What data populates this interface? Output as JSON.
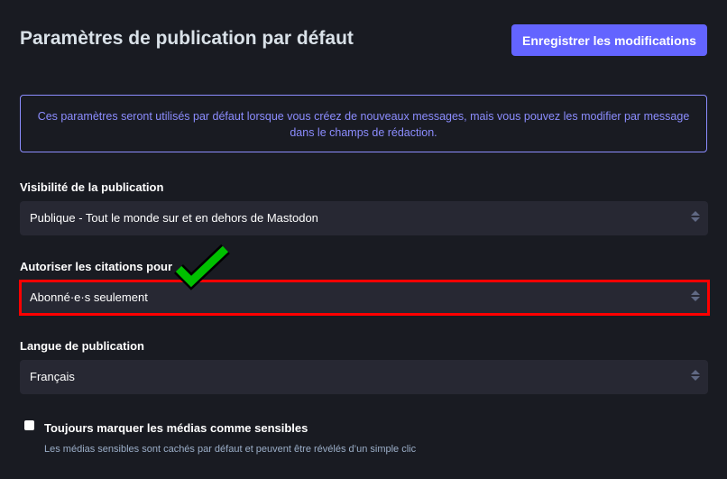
{
  "header": {
    "title": "Paramètres de publication par défaut",
    "save_label": "Enregistrer les modifications"
  },
  "notice": "Ces paramètres seront utilisés par défaut lorsque vous créez de nouveaux messages, mais vous pouvez les modifier par message dans le champs de rédaction.",
  "visibility": {
    "label": "Visibilité de la publication",
    "value": "Publique - Tout le monde sur et en dehors de Mastodon"
  },
  "quotes": {
    "label": "Autoriser les citations pour",
    "value": "Abonné·e·s seulement"
  },
  "language": {
    "label": "Langue de publication",
    "value": "Français"
  },
  "sensitive": {
    "label": "Toujours marquer les médias comme sensibles",
    "hint": "Les médias sensibles sont cachés par défaut et peuvent être révélés d’un simple clic",
    "checked": false
  },
  "colors": {
    "accent": "#6364ff",
    "highlight": "#ff0000",
    "check": "#00c000"
  }
}
